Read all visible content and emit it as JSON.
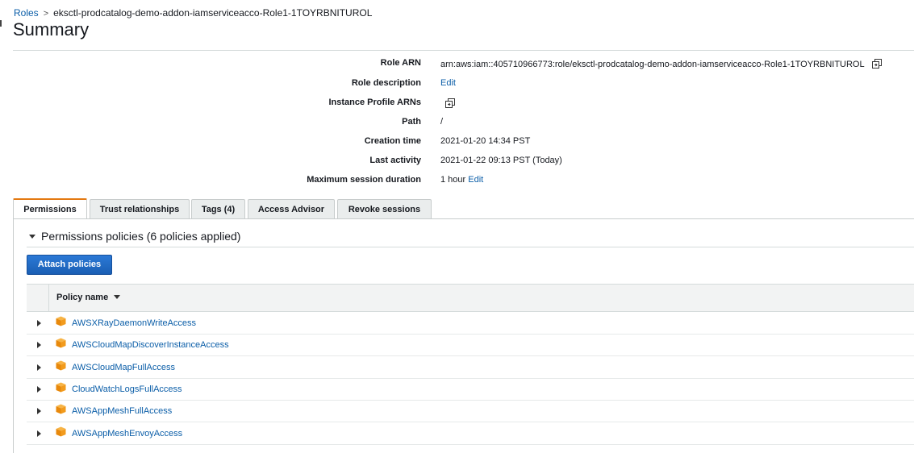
{
  "breadcrumb": {
    "parent": "Roles",
    "separator": ">",
    "current": "eksctl-prodcatalog-demo-addon-iamserviceacco-Role1-1TOYRBNITUROL"
  },
  "title": "Summary",
  "summary": {
    "role_arn": {
      "label": "Role ARN",
      "value": "arn:aws:iam::405710966773:role/eksctl-prodcatalog-demo-addon-iamserviceacco-Role1-1TOYRBNITUROL",
      "icon": "copy-icon"
    },
    "role_description": {
      "label": "Role description",
      "link": "Edit"
    },
    "instance_profile_arns": {
      "label": "Instance Profile ARNs",
      "icon": "copy-icon"
    },
    "path": {
      "label": "Path",
      "value": "/"
    },
    "creation_time": {
      "label": "Creation time",
      "value": "2021-01-20 14:34 PST"
    },
    "last_activity": {
      "label": "Last activity",
      "value": "2021-01-22 09:13 PST (Today)"
    },
    "max_session": {
      "label": "Maximum session duration",
      "value": "1 hour",
      "link": "Edit"
    }
  },
  "tabs": [
    "Permissions",
    "Trust relationships",
    "Tags (4)",
    "Access Advisor",
    "Revoke sessions"
  ],
  "active_tab": "Permissions",
  "permissions": {
    "heading": "Permissions policies (6 policies applied)",
    "attach_button": "Attach policies",
    "column_header": "Policy name",
    "policies": [
      "AWSXRayDaemonWriteAccess",
      "AWSCloudMapDiscoverInstanceAccess",
      "AWSCloudMapFullAccess",
      "CloudWatchLogsFullAccess",
      "AWSAppMeshFullAccess",
      "AWSAppMeshEnvoyAccess"
    ]
  },
  "colors": {
    "link": "#0b5ea8",
    "tab_accent": "#e47911",
    "button": "#1a5fb4",
    "policy_icon": "#f29b1d"
  }
}
